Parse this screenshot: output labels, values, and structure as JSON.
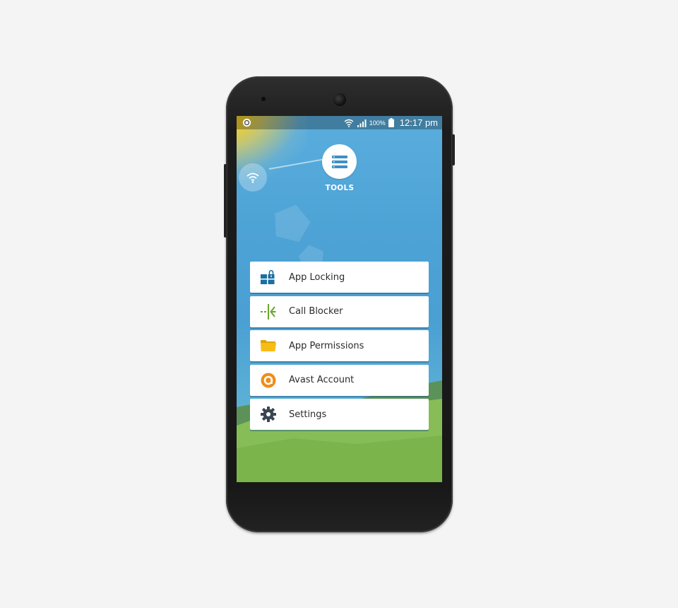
{
  "status_bar": {
    "battery_percent": "100%",
    "time": "12:17 pm"
  },
  "header": {
    "title": "TOOLS"
  },
  "menu": {
    "items": [
      {
        "label": "App Locking",
        "icon": "app-locking-icon",
        "color": "#1a6fa3"
      },
      {
        "label": "Call Blocker",
        "icon": "call-blocker-icon",
        "color": "#6aa62c"
      },
      {
        "label": "App Permissions",
        "icon": "folder-icon",
        "color": "#f5b800"
      },
      {
        "label": "Avast Account",
        "icon": "avast-logo-icon",
        "color": "#f08c1a"
      },
      {
        "label": "Settings",
        "icon": "gear-icon",
        "color": "#3a4652"
      }
    ]
  },
  "colors": {
    "sky": "#4ea3d6",
    "sun": "#f6d11a",
    "grass": "#7db84a"
  }
}
